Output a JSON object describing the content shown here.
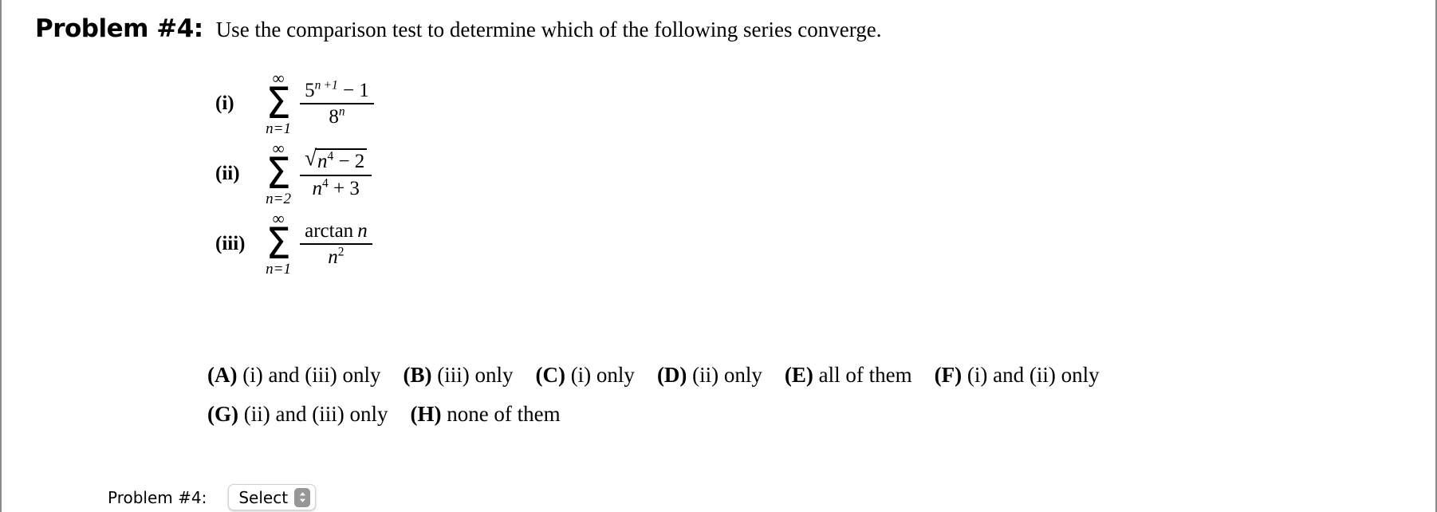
{
  "header": {
    "problem_label": "Problem #4:",
    "statement": "Use the comparison test to determine which of the following series converge."
  },
  "series": [
    {
      "tag": "(i)",
      "sum_upper": "∞",
      "sum_lower": "n=1",
      "numerator": "5^{n+1} − 1",
      "denominator": "8^{n}",
      "expression": "sum_{n=1}^{infty} (5^(n+1) - 1)/(8^n)"
    },
    {
      "tag": "(ii)",
      "sum_upper": "∞",
      "sum_lower": "n=2",
      "numerator": "√(n^4 − 2)",
      "denominator": "n^4 + 3",
      "expression": "sum_{n=2}^{infty} sqrt(n^4 - 2)/(n^4 + 3)"
    },
    {
      "tag": "(iii)",
      "sum_upper": "∞",
      "sum_lower": "n=1",
      "numerator": "arctan n",
      "denominator": "n^2",
      "expression": "sum_{n=1}^{infty} arctan(n)/(n^2)"
    }
  ],
  "choices": [
    [
      {
        "letter": "(A)",
        "text": "(i) and (iii) only"
      },
      {
        "letter": "(B)",
        "text": "(iii) only"
      },
      {
        "letter": "(C)",
        "text": "(i) only"
      },
      {
        "letter": "(D)",
        "text": "(ii) only"
      },
      {
        "letter": "(E)",
        "text": "all of them"
      },
      {
        "letter": "(F)",
        "text": "(i) and (ii) only"
      }
    ],
    [
      {
        "letter": "(G)",
        "text": "(ii) and (iii) only"
      },
      {
        "letter": "(H)",
        "text": "none of them"
      }
    ]
  ],
  "answer": {
    "label": "Problem #4:",
    "select_value": "Select",
    "stepper_icon": "up-down-chevron-icon"
  }
}
